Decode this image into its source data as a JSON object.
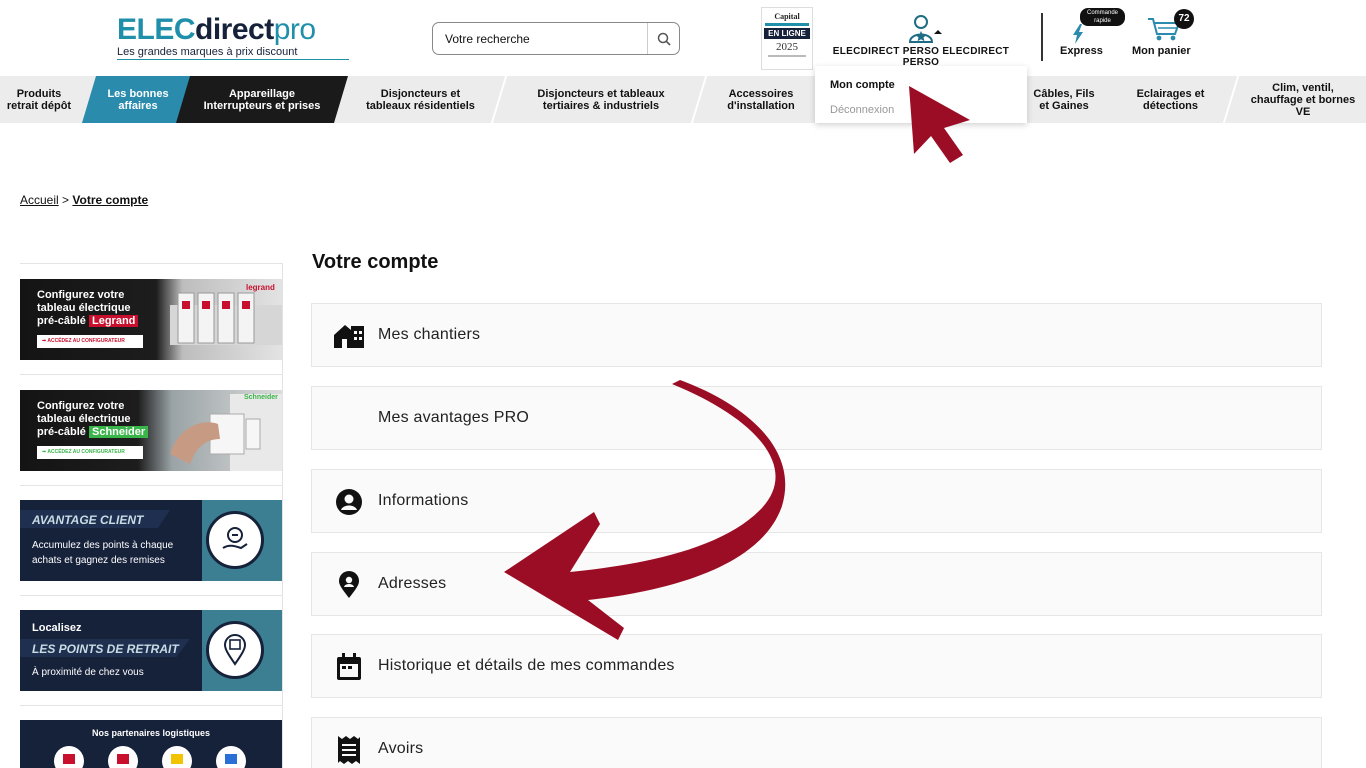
{
  "header": {
    "logo": {
      "part1": "ELEC",
      "part2": "direct",
      "part3": "pro",
      "tagline": "Les grandes marques à prix discount"
    },
    "search": {
      "placeholder": "Votre recherche"
    },
    "award": {
      "brand": "Capital",
      "band": "EN LIGNE",
      "year": "2025"
    },
    "account_name": "ELECDIRECT PERSO ELECDIRECT PERSO",
    "express": {
      "badge": "Commande rapide",
      "label": "Express"
    },
    "cart": {
      "label": "Mon panier",
      "count": "72"
    }
  },
  "nav": {
    "items": [
      {
        "line1": "Produits",
        "line2": "retrait dépôt"
      },
      {
        "line1": "Les bonnes",
        "line2": "affaires"
      },
      {
        "line1": "Appareillage",
        "line2": "Interrupteurs et prises"
      },
      {
        "line1": "Disjoncteurs et",
        "line2": "tableaux résidentiels"
      },
      {
        "line1": "Disjoncteurs et tableaux",
        "line2": "tertiaires & industriels"
      },
      {
        "line1": "Accessoires",
        "line2": "d'installation"
      },
      {
        "line1": "Câbles, Fils",
        "line2": "et Gaines"
      },
      {
        "line1": "Eclairages et",
        "line2": "détections"
      },
      {
        "line1": "Clim, ventil,",
        "line2": "chauffage et bornes",
        "line3": "VE"
      }
    ],
    "colors": {
      "deal": "#2a8bad",
      "dark": "#1a1a1a",
      "bar": "#ececec"
    }
  },
  "dropdown": {
    "item1": "Mon compte",
    "item2": "Déconnexion"
  },
  "breadcrumb": {
    "home": "Accueil",
    "separator": ">",
    "current": "Votre compte"
  },
  "sidebar": {
    "banner1": {
      "line1": "Configurez votre",
      "line2": "tableau électrique",
      "line3_prefix": "pré-câblé",
      "brand": "Legrand",
      "button": "➡ ACCÉDEZ AU CONFIGURATEUR",
      "logo": "legrand"
    },
    "banner2": {
      "line1": "Configurez votre",
      "line2": "tableau électrique",
      "line3_prefix": "pré-câblé",
      "brand": "Schneider",
      "button": "➡ ACCÉDEZ AU CONFIGURATEUR",
      "logo": "Schneider"
    },
    "banner3": {
      "title": "AVANTAGE CLIENT",
      "line1": "Accumulez des points à chaque",
      "line2": "achats et gagnez des remises"
    },
    "banner4": {
      "line1": "Localisez",
      "title": "LES POINTS DE RETRAIT",
      "line2": "À proximité de chez vous"
    },
    "banner5": {
      "title": "Nos partenaires logistiques"
    }
  },
  "main": {
    "title": "Votre compte",
    "rows": [
      {
        "label": "Mes chantiers",
        "icon": "house-icon"
      },
      {
        "label": "Mes avantages PRO",
        "icon": ""
      },
      {
        "label": "Informations",
        "icon": "user-circle-icon"
      },
      {
        "label": "Adresses",
        "icon": "location-pin-icon"
      },
      {
        "label": "Historique et détails de mes commandes",
        "icon": "calendar-icon"
      },
      {
        "label": "Avoirs",
        "icon": "receipt-icon"
      }
    ]
  },
  "annotation_color": "#9b0d24"
}
